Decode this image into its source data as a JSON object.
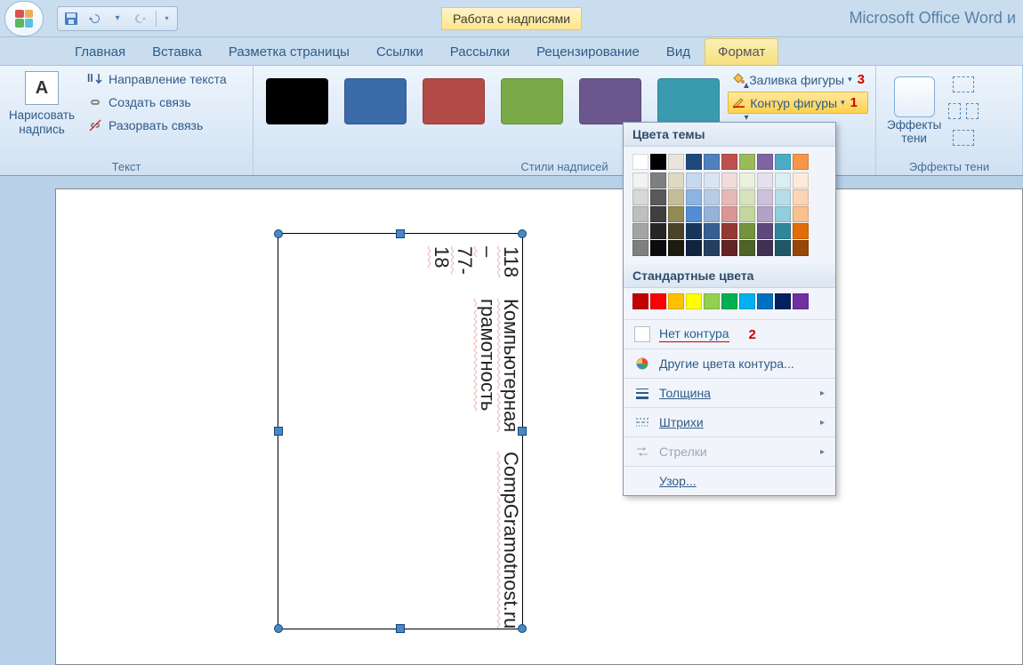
{
  "app_name": "Microsoft Office Word и",
  "contextual_tab": "Работа с надписями",
  "tabs": {
    "home": "Главная",
    "insert": "Вставка",
    "layout": "Разметка страницы",
    "references": "Ссылки",
    "mailings": "Рассылки",
    "review": "Рецензирование",
    "view": "Вид",
    "format": "Формат"
  },
  "ribbon": {
    "text_group": {
      "label": "Текст",
      "draw": "Нарисовать\nнадпись",
      "direction": "Направление текста",
      "link": "Создать связь",
      "break": "Разорвать связь"
    },
    "styles_group": {
      "label": "Стили надписей",
      "fill": "Заливка фигуры",
      "outline": "Контур фигуры",
      "annot_fill": "3",
      "annot_outline": "1"
    },
    "shadow_group": {
      "label": "Эффекты тени",
      "label_btn": "Эффекты\nтени"
    }
  },
  "style_thumbs": [
    "#000000",
    "#3a6aa8",
    "#b24a46",
    "#7aaa47",
    "#6b568e",
    "#3a9ab0"
  ],
  "dropdown": {
    "theme_title": "Цвета темы",
    "std_title": "Стандартные цвета",
    "no_outline": "Нет контура",
    "no_outline_annot": "2",
    "more_colors": "Другие цвета контура...",
    "weight": "Толщина",
    "dashes": "Штрихи",
    "arrows": "Стрелки",
    "pattern": "Узор..."
  },
  "theme_colors_row": [
    "#ffffff",
    "#000000",
    "#e9e5dc",
    "#1f497d",
    "#4f81bd",
    "#c0504d",
    "#9bbb59",
    "#8064a2",
    "#4bacc6",
    "#f79646"
  ],
  "theme_tint_matrix": [
    [
      "#f2f2f2",
      "#7f7f7f",
      "#ddd9c3",
      "#c6d9f0",
      "#dbe5f1",
      "#f2dcdb",
      "#ebf1dd",
      "#e5e0ec",
      "#dbeef3",
      "#fdeada"
    ],
    [
      "#d8d8d8",
      "#595959",
      "#c4bd97",
      "#8db3e2",
      "#b8cce4",
      "#e5b9b7",
      "#d7e3bc",
      "#ccc1d9",
      "#b7dde8",
      "#fbd5b5"
    ],
    [
      "#bfbfbf",
      "#3f3f3f",
      "#938953",
      "#548dd4",
      "#95b3d7",
      "#d99694",
      "#c3d69b",
      "#b2a2c7",
      "#92cddc",
      "#fac08f"
    ],
    [
      "#a5a5a5",
      "#262626",
      "#494429",
      "#17365d",
      "#366092",
      "#953734",
      "#76923c",
      "#5f497a",
      "#31859b",
      "#e36c09"
    ],
    [
      "#7f7f7f",
      "#0c0c0c",
      "#1d1b10",
      "#0f243e",
      "#244061",
      "#632423",
      "#4f6228",
      "#3f3151",
      "#205867",
      "#974806"
    ]
  ],
  "standard_colors": [
    "#c00000",
    "#ff0000",
    "#ffc000",
    "#ffff00",
    "#92d050",
    "#00b050",
    "#00b0f0",
    "#0070c0",
    "#002060",
    "#7030a0"
  ],
  "textbox": {
    "line1": "118 – 77- 18",
    "line2": "Компьютерная грамотность",
    "line3": "CompGramotnost.ru"
  }
}
